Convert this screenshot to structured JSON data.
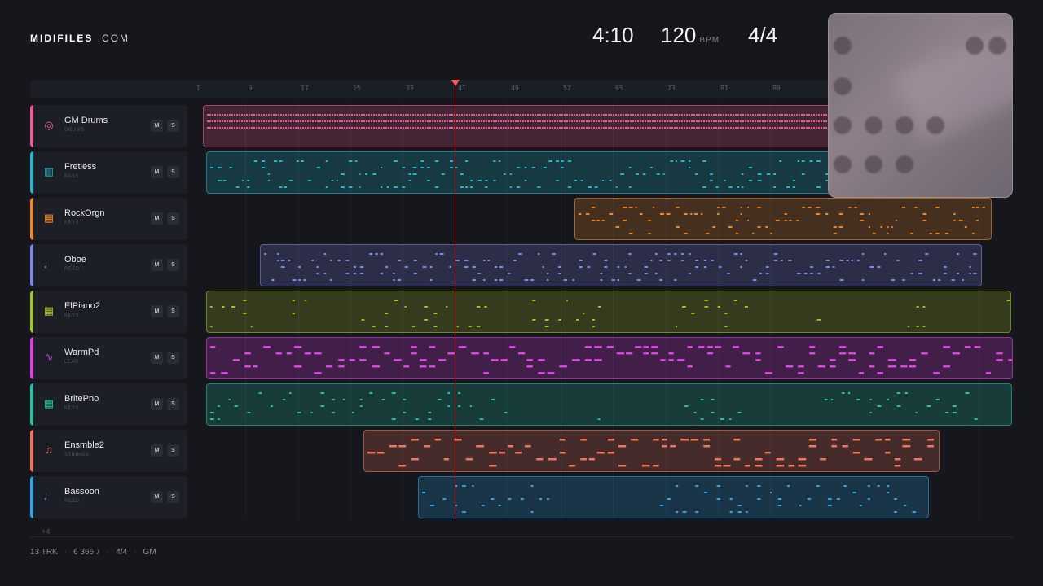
{
  "header": {
    "logo_main": "MIDIFILES",
    "logo_suffix": ".COM",
    "duration": "4:10",
    "tempo": "120",
    "tempo_unit": "BPM",
    "time_signature": "4/4"
  },
  "ruler": {
    "labels": [
      "1",
      "9",
      "17",
      "25",
      "33",
      "41",
      "49",
      "57",
      "65",
      "73",
      "81",
      "89"
    ]
  },
  "tracks": [
    {
      "name": "GM Drums",
      "category": "DRUMS",
      "color": "#ee5a95",
      "icon": "drum-icon",
      "glyph": "◎",
      "mute": "M",
      "solo": "S"
    },
    {
      "name": "Fretless",
      "category": "BASS",
      "color": "#22b7cc",
      "icon": "bass-icon",
      "glyph": "▥",
      "mute": "M",
      "solo": "S"
    },
    {
      "name": "RockOrgn",
      "category": "KEYS",
      "color": "#f0882a",
      "icon": "keyboard-icon",
      "glyph": "▦",
      "mute": "M",
      "solo": "S"
    },
    {
      "name": "Oboe",
      "category": "REED",
      "color": "#7f86e8",
      "icon": "reed-icon",
      "glyph": "♩",
      "mute": "M",
      "solo": "S"
    },
    {
      "name": "ElPiano2",
      "category": "KEYS",
      "color": "#a8c22a",
      "icon": "keyboard-icon",
      "glyph": "▦",
      "mute": "M",
      "solo": "S"
    },
    {
      "name": "WarmPd",
      "category": "LEAD",
      "color": "#e040e6",
      "icon": "waveform-icon",
      "glyph": "∿",
      "mute": "M",
      "solo": "S"
    },
    {
      "name": "BritePno",
      "category": "KEYS",
      "color": "#22c4a4",
      "icon": "keyboard-icon",
      "glyph": "▦",
      "mute": "M",
      "solo": "S"
    },
    {
      "name": "Ensmble2",
      "category": "STRINGS",
      "color": "#f2765a",
      "icon": "violin-icon",
      "glyph": "♫",
      "mute": "M",
      "solo": "S"
    },
    {
      "name": "Bassoon",
      "category": "REED",
      "color": "#2ea3e8",
      "icon": "reed-icon",
      "glyph": "♩",
      "mute": "M",
      "solo": "S"
    }
  ],
  "more_tracks": "+4",
  "footer": {
    "tracks": "13 TRK",
    "notes": "6 366 ♪",
    "time_signature": "4/4",
    "standard": "GM"
  },
  "colors": {
    "background": "#15171c",
    "playhead": "#ff5a5a"
  }
}
